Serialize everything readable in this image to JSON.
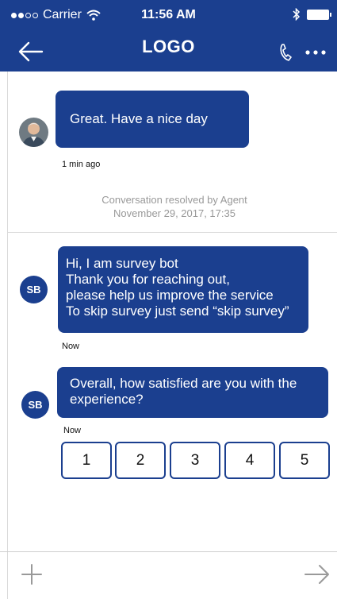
{
  "status_bar": {
    "carrier": "Carrier",
    "time": "11:56 AM",
    "signal_dots_filled": 2,
    "signal_dots_total": 4
  },
  "header": {
    "title": "LOGO",
    "icons": {
      "back": "arrow-left-icon",
      "call": "phone-icon",
      "more": "more-icon"
    }
  },
  "colors": {
    "brand": "#1b3f8f",
    "muted_text": "#999999",
    "background": "#ffffff"
  },
  "chat": {
    "agent_message": {
      "text": "Great. Have a nice day",
      "time": "1 min ago"
    },
    "system_notice": {
      "line1": "Conversation resolved by Agent",
      "line2": "November 29, 2017, 17:35"
    },
    "bot_message_1": {
      "avatar_initials": "SB",
      "lines": [
        "Hi, I am survey bot",
        "Thank you for reaching out,",
        "please help us improve the service",
        "To skip survey just send “skip survey”"
      ],
      "time": "Now"
    },
    "bot_message_2": {
      "avatar_initials": "SB",
      "lines": [
        "Overall, how satisfied are you with the",
        "experience?"
      ],
      "time": "Now"
    },
    "rating_options": [
      "1",
      "2",
      "3",
      "4",
      "5"
    ]
  },
  "input_bar": {
    "icons": {
      "add": "plus-icon",
      "send": "arrow-right-icon"
    }
  }
}
